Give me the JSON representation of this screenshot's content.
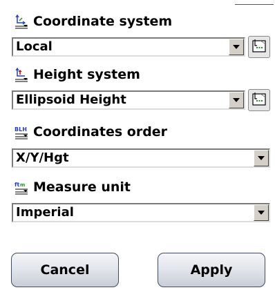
{
  "coordinate_system": {
    "label": "Coordinate system",
    "value": "Local",
    "icon": "coordinate-axes-icon"
  },
  "height_system": {
    "label": "Height system",
    "value": "Ellipsoid Height",
    "icon": "height-axes-icon"
  },
  "coordinates_order": {
    "label": "Coordinates order",
    "value": "X/Y/Hgt",
    "icon": "blh-order-icon"
  },
  "measure_unit": {
    "label": "Measure unit",
    "value": "Imperial",
    "icon": "measure-unit-icon"
  },
  "buttons": {
    "cancel": "Cancel",
    "apply": "Apply"
  },
  "colors": {
    "button_border": "#3f4a5c",
    "icon_green": "#2e8b2e",
    "icon_blue": "#1f3fbf"
  }
}
